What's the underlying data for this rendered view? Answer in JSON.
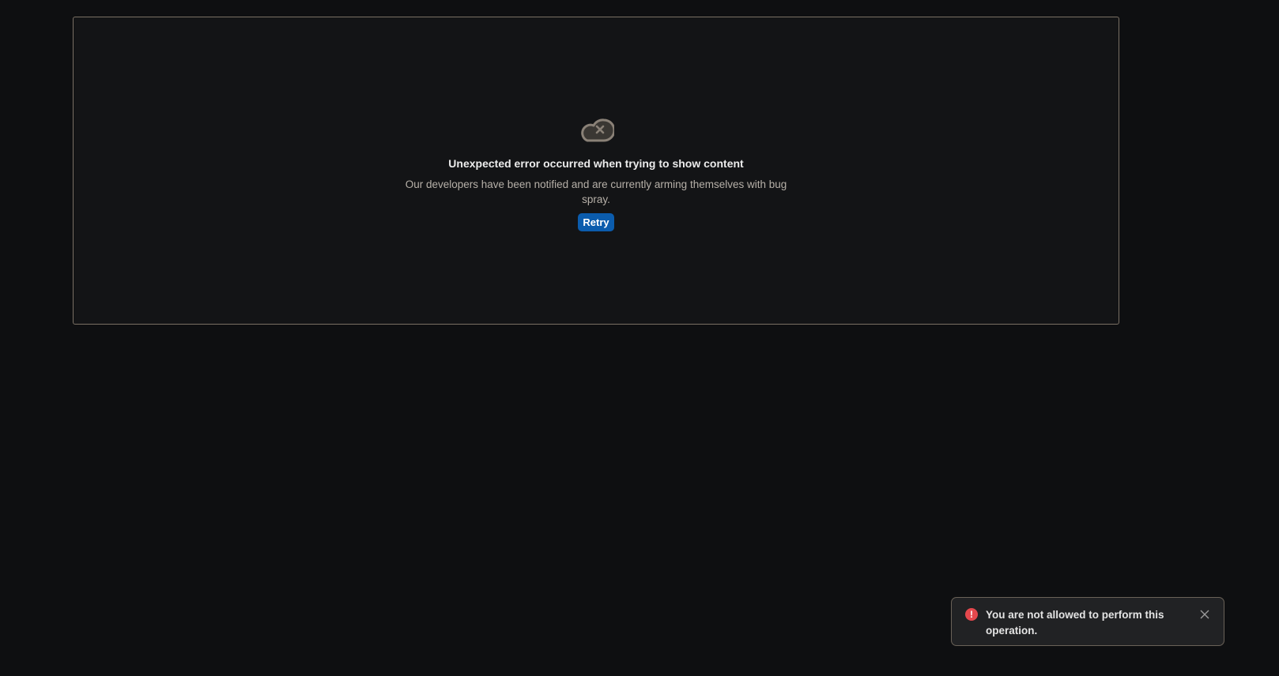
{
  "error": {
    "icon": "cloud-error-icon",
    "title": "Unexpected error occurred when trying to show content",
    "description": "Our developers have been notified and are currently arming themselves with bug spray.",
    "retry_label": "Retry",
    "icon_color": "#8a8177",
    "button_color": "#0b5cad"
  },
  "toast": {
    "icon": "alert-circle-icon",
    "icon_glyph": "!",
    "message": "You are not allowed to perform this operation.",
    "close_icon": "close-icon",
    "icon_color": "#e5484d"
  }
}
